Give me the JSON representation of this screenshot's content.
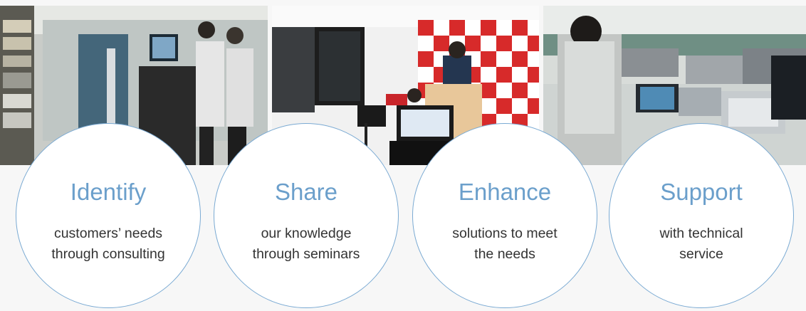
{
  "steps": [
    {
      "title": "Identify",
      "lines": [
        "customers’ needs",
        "through consulting"
      ]
    },
    {
      "title": "Share",
      "lines": [
        "our knowledge",
        "through seminars"
      ]
    },
    {
      "title": "Enhance",
      "lines": [
        "solutions to meet",
        "the needs"
      ]
    },
    {
      "title": "Support",
      "lines": [
        "with technical",
        "service"
      ]
    }
  ],
  "colors": {
    "accent": "#6b9fcb",
    "circle_border": "#7aaad3",
    "text": "#333333"
  }
}
